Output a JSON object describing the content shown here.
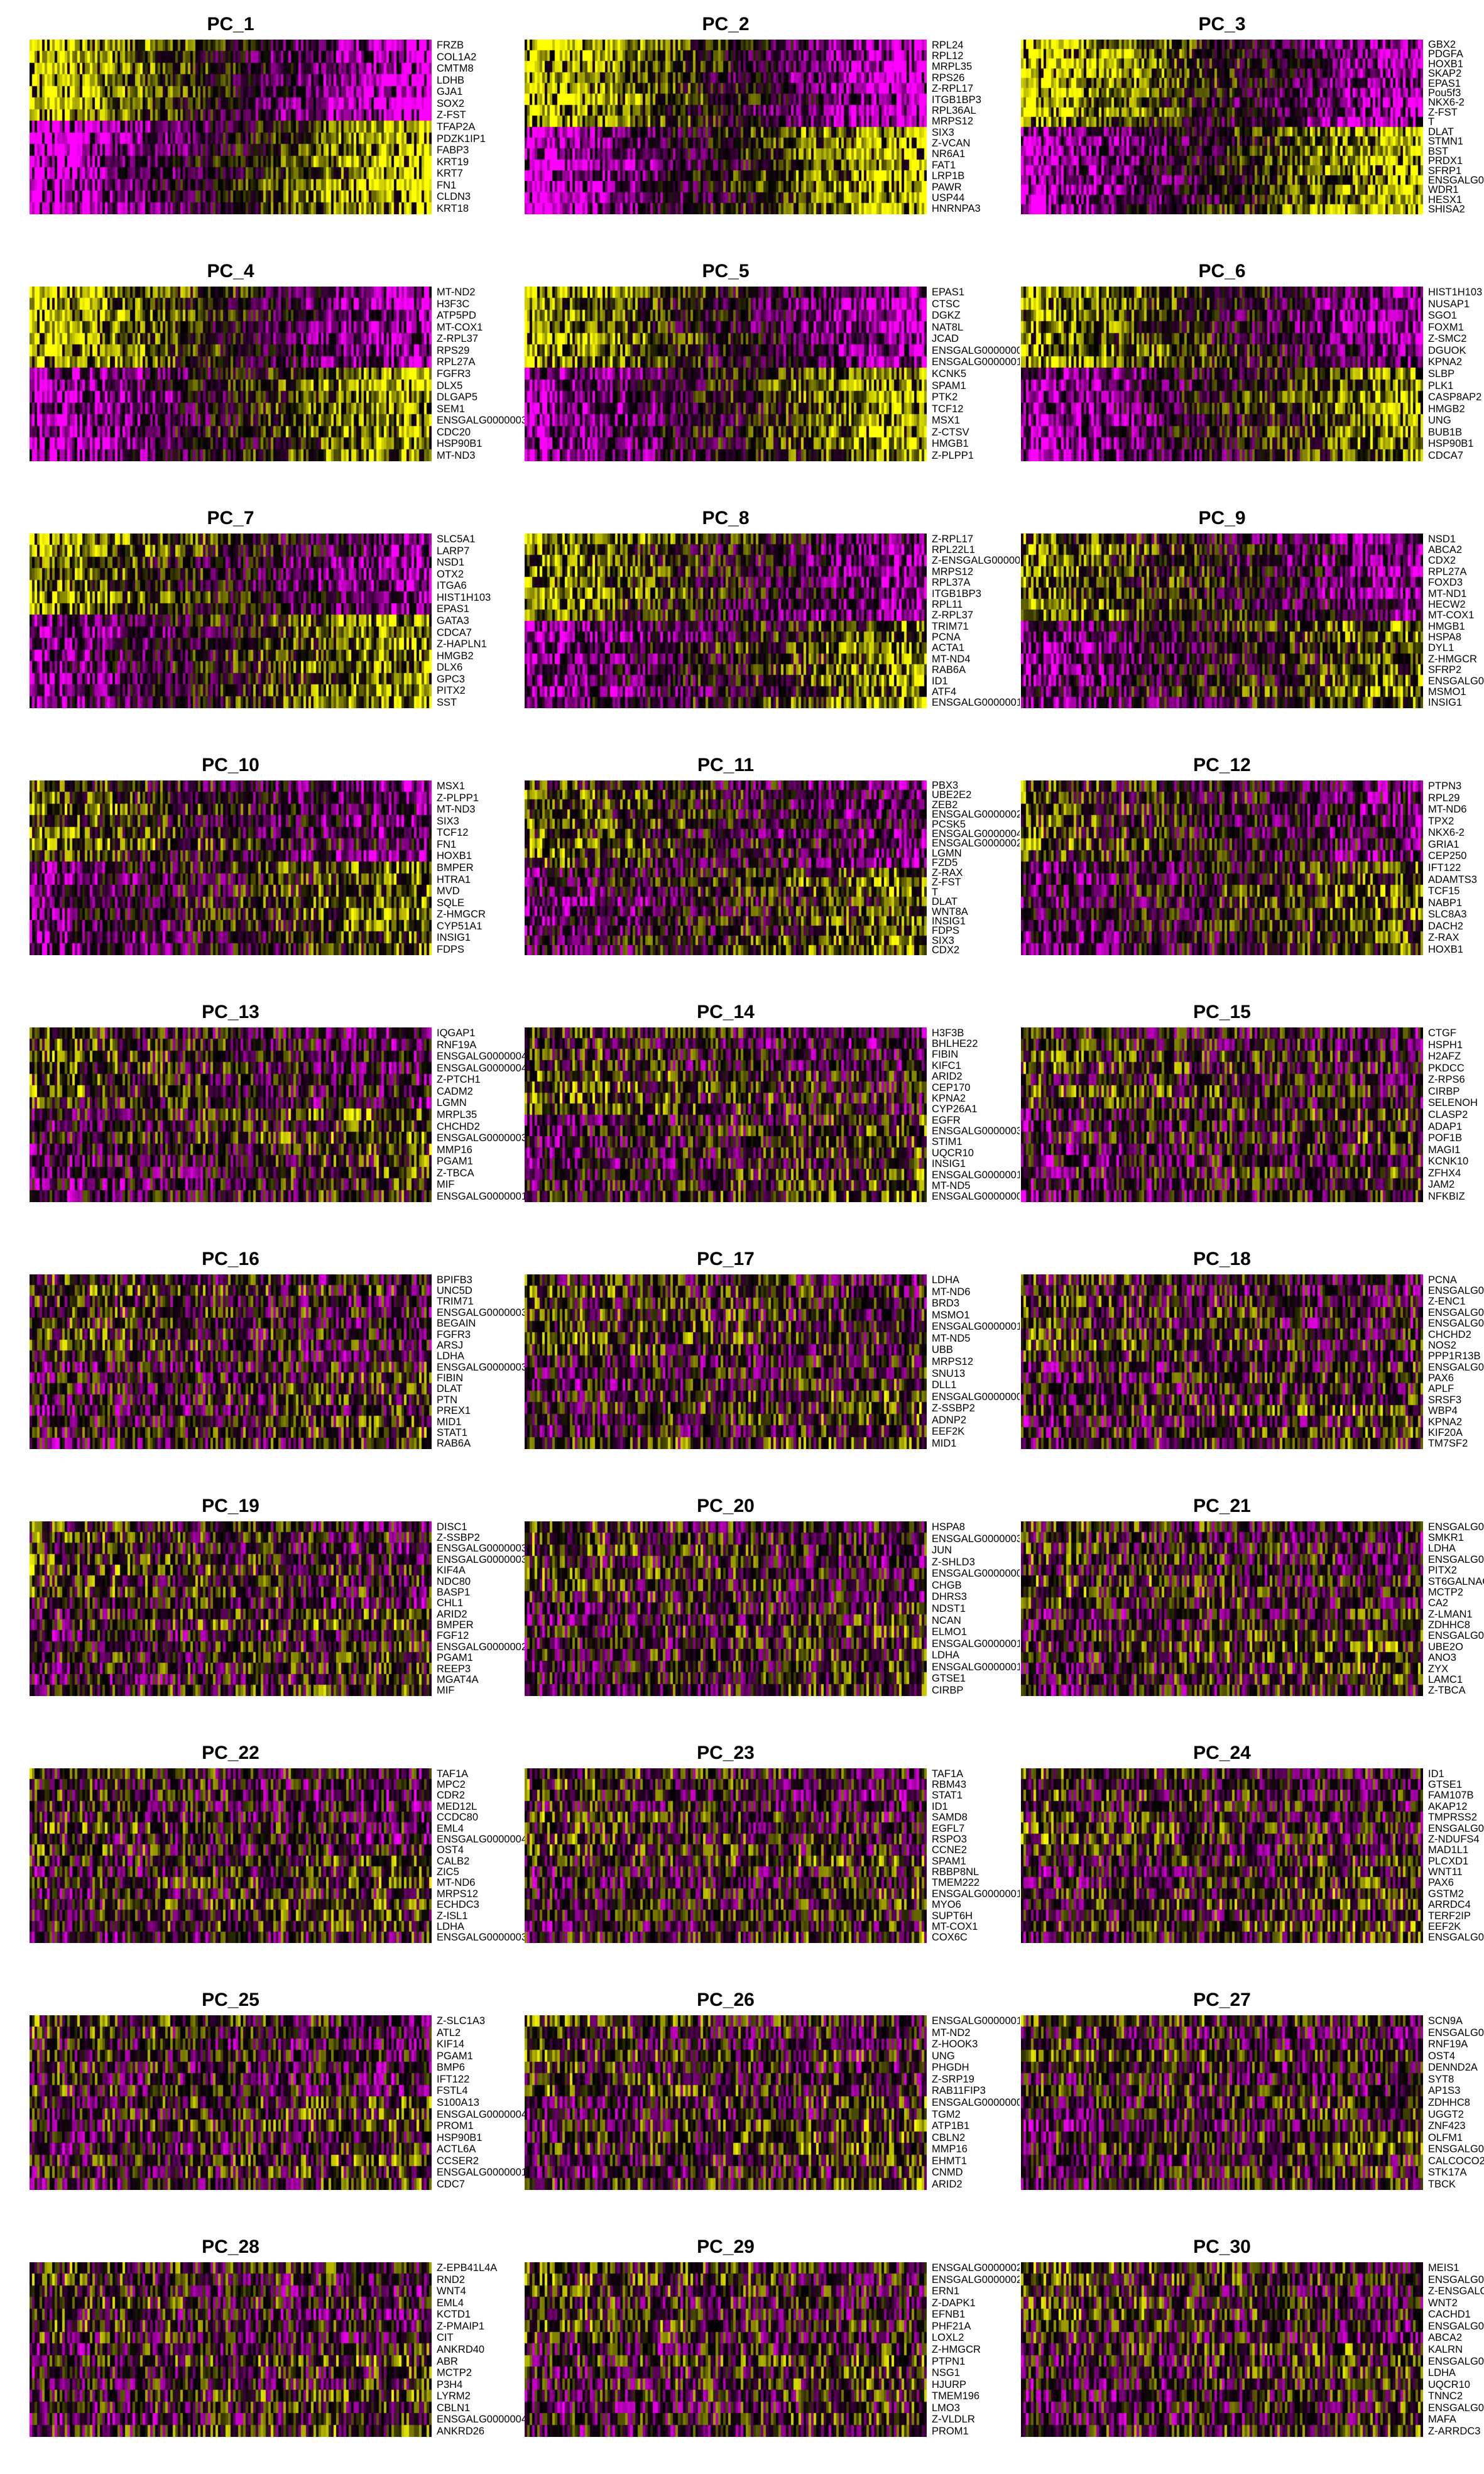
{
  "figure": {
    "colormap": [
      "#ff00ff",
      "#000000",
      "#ffff00"
    ],
    "panels": [
      {
        "title": "PC_1",
        "genes": [
          "FRZB",
          "COL1A2",
          "CMTM8",
          "LDHB",
          "GJA1",
          "SOX2",
          "Z-FST",
          "TFAP2A",
          "PDZK1IP1",
          "FABP3",
          "KRT19",
          "KRT7",
          "FN1",
          "CLDN3",
          "KRT18"
        ]
      },
      {
        "title": "PC_2",
        "genes": [
          "RPL24",
          "RPL12",
          "MRPL35",
          "RPS26",
          "Z-RPL17",
          "ITGB1BP3",
          "RPL36AL",
          "MRPS12",
          "SIX3",
          "Z-VCAN",
          "NR6A1",
          "FAT1",
          "LRP1B",
          "PAWR",
          "USP44",
          "HNRNPA3"
        ]
      },
      {
        "title": "PC_3",
        "genes": [
          "GBX2",
          "PDGFA",
          "HOXB1",
          "SKAP2",
          "EPAS1",
          "Pou5f3",
          "NKX6-2",
          "Z-FST",
          "T",
          "DLAT",
          "STMN1",
          "BST",
          "PRDX1",
          "SFRP1",
          "ENSGALG00",
          "WDR1",
          "HESX1",
          "SHISA2"
        ]
      },
      {
        "title": "PC_4",
        "genes": [
          "MT-ND2",
          "H3F3C",
          "ATP5PD",
          "MT-COX1",
          "Z-RPL37",
          "RPS29",
          "RPL27A",
          "FGFR3",
          "DLX5",
          "DLGAP5",
          "SEM1",
          "ENSGALG0000003",
          "CDC20",
          "HSP90B1",
          "MT-ND3"
        ]
      },
      {
        "title": "PC_5",
        "genes": [
          "EPAS1",
          "CTSC",
          "DGKZ",
          "NAT8L",
          "JCAD",
          "ENSGALG0000000",
          "ENSGALG0000001",
          "KCNK5",
          "SPAM1",
          "PTK2",
          "TCF12",
          "MSX1",
          "Z-CTSV",
          "HMGB1",
          "Z-PLPP1"
        ]
      },
      {
        "title": "PC_6",
        "genes": [
          "HIST1H103",
          "NUSAP1",
          "SGO1",
          "FOXM1",
          "Z-SMC2",
          "DGUOK",
          "KPNA2",
          "SLBP",
          "PLK1",
          "CASP8AP2",
          "HMGB2",
          "UNG",
          "BUB1B",
          "HSP90B1",
          "CDCA7"
        ]
      },
      {
        "title": "PC_7",
        "genes": [
          "SLC5A1",
          "LARP7",
          "NSD1",
          "OTX2",
          "ITGA6",
          "HIST1H103",
          "EPAS1",
          "GATA3",
          "CDCA7",
          "Z-HAPLN1",
          "HMGB2",
          "DLX6",
          "GPC3",
          "PITX2",
          "SST"
        ]
      },
      {
        "title": "PC_8",
        "genes": [
          "Z-RPL17",
          "RPL22L1",
          "Z-ENSGALG000000",
          "MRPS12",
          "RPL37A",
          "ITGB1BP3",
          "RPL11",
          "Z-RPL37",
          "TRIM71",
          "PCNA",
          "ACTA1",
          "MT-ND4",
          "RAB6A",
          "ID1",
          "ATF4",
          "ENSGALG0000001"
        ]
      },
      {
        "title": "PC_9",
        "genes": [
          "NSD1",
          "ABCA2",
          "CDX2",
          "RPL27A",
          "FOXD3",
          "MT-ND1",
          "HECW2",
          "MT-COX1",
          "HMGB1",
          "HSPA8",
          "DYL1",
          "Z-HMGCR",
          "SFRP2",
          "ENSGALG00",
          "MSMO1",
          "INSIG1"
        ]
      },
      {
        "title": "PC_10",
        "genes": [
          "MSX1",
          "Z-PLPP1",
          "MT-ND3",
          "SIX3",
          "TCF12",
          "FN1",
          "HOXB1",
          "BMPER",
          "HTRA1",
          "MVD",
          "SQLE",
          "Z-HMGCR",
          "CYP51A1",
          "INSIG1",
          "FDPS"
        ]
      },
      {
        "title": "PC_11",
        "genes": [
          "PBX3",
          "UBE2E2",
          "ZEB2",
          "ENSGALG0000002",
          "PCSK5",
          "ENSGALG0000004",
          "ENSGALG0000002",
          "LGMN",
          "FZD5",
          "Z-RAX",
          "Z-FST",
          "T",
          "DLAT",
          "WNT8A",
          "INSIG1",
          "FDPS",
          "SIX3",
          "CDX2"
        ]
      },
      {
        "title": "PC_12",
        "genes": [
          "PTPN3",
          "RPL29",
          "MT-ND6",
          "TPX2",
          "NKX6-2",
          "GRIA1",
          "CEP250",
          "IFT122",
          "ADAMTS3",
          "TCF15",
          "NABP1",
          "SLC8A3",
          "DACH2",
          "Z-RAX",
          "HOXB1"
        ]
      },
      {
        "title": "PC_13",
        "genes": [
          "IQGAP1",
          "RNF19A",
          "ENSGALG0000004",
          "ENSGALG0000004",
          "Z-PTCH1",
          "CADM2",
          "LGMN",
          "MRPL35",
          "CHCHD2",
          "ENSGALG0000003",
          "MMP16",
          "PGAM1",
          "Z-TBCA",
          "MIF",
          "ENSGALG0000001"
        ]
      },
      {
        "title": "PC_14",
        "genes": [
          "H3F3B",
          "BHLHE22",
          "FIBIN",
          "KIFC1",
          "ARID2",
          "CEP170",
          "KPNA2",
          "CYP26A1",
          "EGFR",
          "ENSGALG0000003",
          "STIM1",
          "UQCR10",
          "INSIG1",
          "ENSGALG0000001",
          "MT-ND5",
          "ENSGALG0000000"
        ]
      },
      {
        "title": "PC_15",
        "genes": [
          "CTGF",
          "HSPH1",
          "H2AFZ",
          "PKDCC",
          "Z-RPS6",
          "CIRBP",
          "SELENOH",
          "CLASP2",
          "ADAP1",
          "POF1B",
          "MAGI1",
          "KCNK10",
          "ZFHX4",
          "JAM2",
          "NFKBIZ"
        ]
      },
      {
        "title": "PC_16",
        "genes": [
          "BPIFB3",
          "UNC5D",
          "TRIM71",
          "ENSGALG0000003",
          "BEGAIN",
          "FGFR3",
          "ARSJ",
          "LDHA",
          "ENSGALG0000003",
          "FIBIN",
          "DLAT",
          "PTN",
          "PREX1",
          "MID1",
          "STAT1",
          "RAB6A"
        ]
      },
      {
        "title": "PC_17",
        "genes": [
          "LDHA",
          "MT-ND6",
          "BRD3",
          "MSMO1",
          "ENSGALG0000001",
          "MT-ND5",
          "UBB",
          "MRPS12",
          "SNU13",
          "DLL1",
          "ENSGALG0000000",
          "Z-SSBP2",
          "ADNP2",
          "EEF2K",
          "MID1"
        ]
      },
      {
        "title": "PC_18",
        "genes": [
          "PCNA",
          "ENSGALG0",
          "Z-ENC1",
          "ENSGALG0",
          "ENSGALG0",
          "CHCHD2",
          "NOS2",
          "PPP1R13B",
          "ENSGALG0",
          "PAX6",
          "APLF",
          "SRSF3",
          "WBP4",
          "KPNA2",
          "KIF20A",
          "TM7SF2"
        ]
      },
      {
        "title": "PC_19",
        "genes": [
          "DISC1",
          "Z-SSBP2",
          "ENSGALG0000003",
          "ENSGALG0000003",
          "KIF4A",
          "NDC80",
          "BASP1",
          "CHL1",
          "ARID2",
          "BMPER",
          "FGF12",
          "ENSGALG0000002",
          "PGAM1",
          "REEP3",
          "MGAT4A",
          "MIF"
        ]
      },
      {
        "title": "PC_20",
        "genes": [
          "HSPA8",
          "ENSGALG0000003",
          "JUN",
          "Z-SHLD3",
          "ENSGALG0000000",
          "CHGB",
          "DHRS3",
          "NDST1",
          "NCAN",
          "ELMO1",
          "ENSGALG0000001",
          "LDHA",
          "ENSGALG0000001",
          "GTSE1",
          "CIRBP"
        ]
      },
      {
        "title": "PC_21",
        "genes": [
          "ENSGALG0",
          "SMKR1",
          "LDHA",
          "ENSGALG0",
          "PITX2",
          "ST6GALNAC",
          "MCTP2",
          "CA2",
          "Z-LMAN1",
          "ZDHHC8",
          "ENSGALG0",
          "UBE2O",
          "ANO3",
          "ZYX",
          "LAMC1",
          "Z-TBCA"
        ]
      },
      {
        "title": "PC_22",
        "genes": [
          "TAF1A",
          "MPC2",
          "CDR2",
          "MED12L",
          "CCDC80",
          "EML4",
          "ENSGALG0000004",
          "OST4",
          "CALB2",
          "ZIC5",
          "MT-ND6",
          "MRPS12",
          "ECHDC3",
          "Z-ISL1",
          "LDHA",
          "ENSGALG0000003"
        ]
      },
      {
        "title": "PC_23",
        "genes": [
          "TAF1A",
          "RBM43",
          "STAT1",
          "ID1",
          "SAMD8",
          "EGFL7",
          "RSPO3",
          "CCNE2",
          "SPAM1",
          "RBBP8NL",
          "TMEM222",
          "ENSGALG0000001",
          "MYO6",
          "SUPT6H",
          "MT-COX1",
          "COX6C"
        ]
      },
      {
        "title": "PC_24",
        "genes": [
          "ID1",
          "GTSE1",
          "FAM107B",
          "AKAP12",
          "TMPRSS2",
          "ENSGALG0",
          "Z-NDUFS4",
          "MAD1L1",
          "PLCXD1",
          "WNT11",
          "PAX6",
          "GSTM2",
          "ARRDC4",
          "TERF2IP",
          "EEF2K",
          "ENSGALG0"
        ]
      },
      {
        "title": "PC_25",
        "genes": [
          "Z-SLC1A3",
          "ATL2",
          "KIF14",
          "PGAM1",
          "BMP6",
          "IFT122",
          "FSTL4",
          "S100A13",
          "ENSGALG0000004",
          "PROM1",
          "HSP90B1",
          "ACTL6A",
          "CCSER2",
          "ENSGALG0000001",
          "CDC7"
        ]
      },
      {
        "title": "PC_26",
        "genes": [
          "ENSGALG0000001",
          "MT-ND2",
          "Z-HOOK3",
          "UNG",
          "PHGDH",
          "Z-SRP19",
          "RAB11FIP3",
          "ENSGALG0000000",
          "TGM2",
          "ATP1B1",
          "CBLN2",
          "MMP16",
          "EHMT1",
          "CNMD",
          "ARID2"
        ]
      },
      {
        "title": "PC_27",
        "genes": [
          "SCN9A",
          "ENSGALG0",
          "RNF19A",
          "OST4",
          "DENND2A",
          "SYT8",
          "AP1S3",
          "ZDHHC8",
          "UGGT2",
          "ZNF423",
          "OLFM1",
          "ENSGALG0",
          "CALCOCO2",
          "STK17A",
          "TBCK"
        ]
      },
      {
        "title": "PC_28",
        "genes": [
          "Z-EPB41L4A",
          "RND2",
          "WNT4",
          "EML4",
          "KCTD1",
          "Z-PMAIP1",
          "CIT",
          "ANKRD40",
          "ABR",
          "MCTP2",
          "P3H4",
          "LYRM2",
          "CBLN1",
          "ENSGALG0000004",
          "ANKRD26"
        ]
      },
      {
        "title": "PC_29",
        "genes": [
          "ENSGALG0000002",
          "ENSGALG0000002",
          "ERN1",
          "Z-DAPK1",
          "EFNB1",
          "PHF21A",
          "LOXL2",
          "Z-HMGCR",
          "PTPN1",
          "NSG1",
          "HJURP",
          "TMEM196",
          "LMO3",
          "Z-VLDLR",
          "PROM1"
        ]
      },
      {
        "title": "PC_30",
        "genes": [
          "MEIS1",
          "ENSGALG0",
          "Z-ENSGALG",
          "WNT2",
          "CACHD1",
          "ENSGALG0",
          "ABCA2",
          "KALRN",
          "ENSGALG0",
          "LDHA",
          "UQCR10",
          "TNNC2",
          "ENSGALG0",
          "MAFA",
          "Z-ARRDC3"
        ]
      }
    ]
  }
}
